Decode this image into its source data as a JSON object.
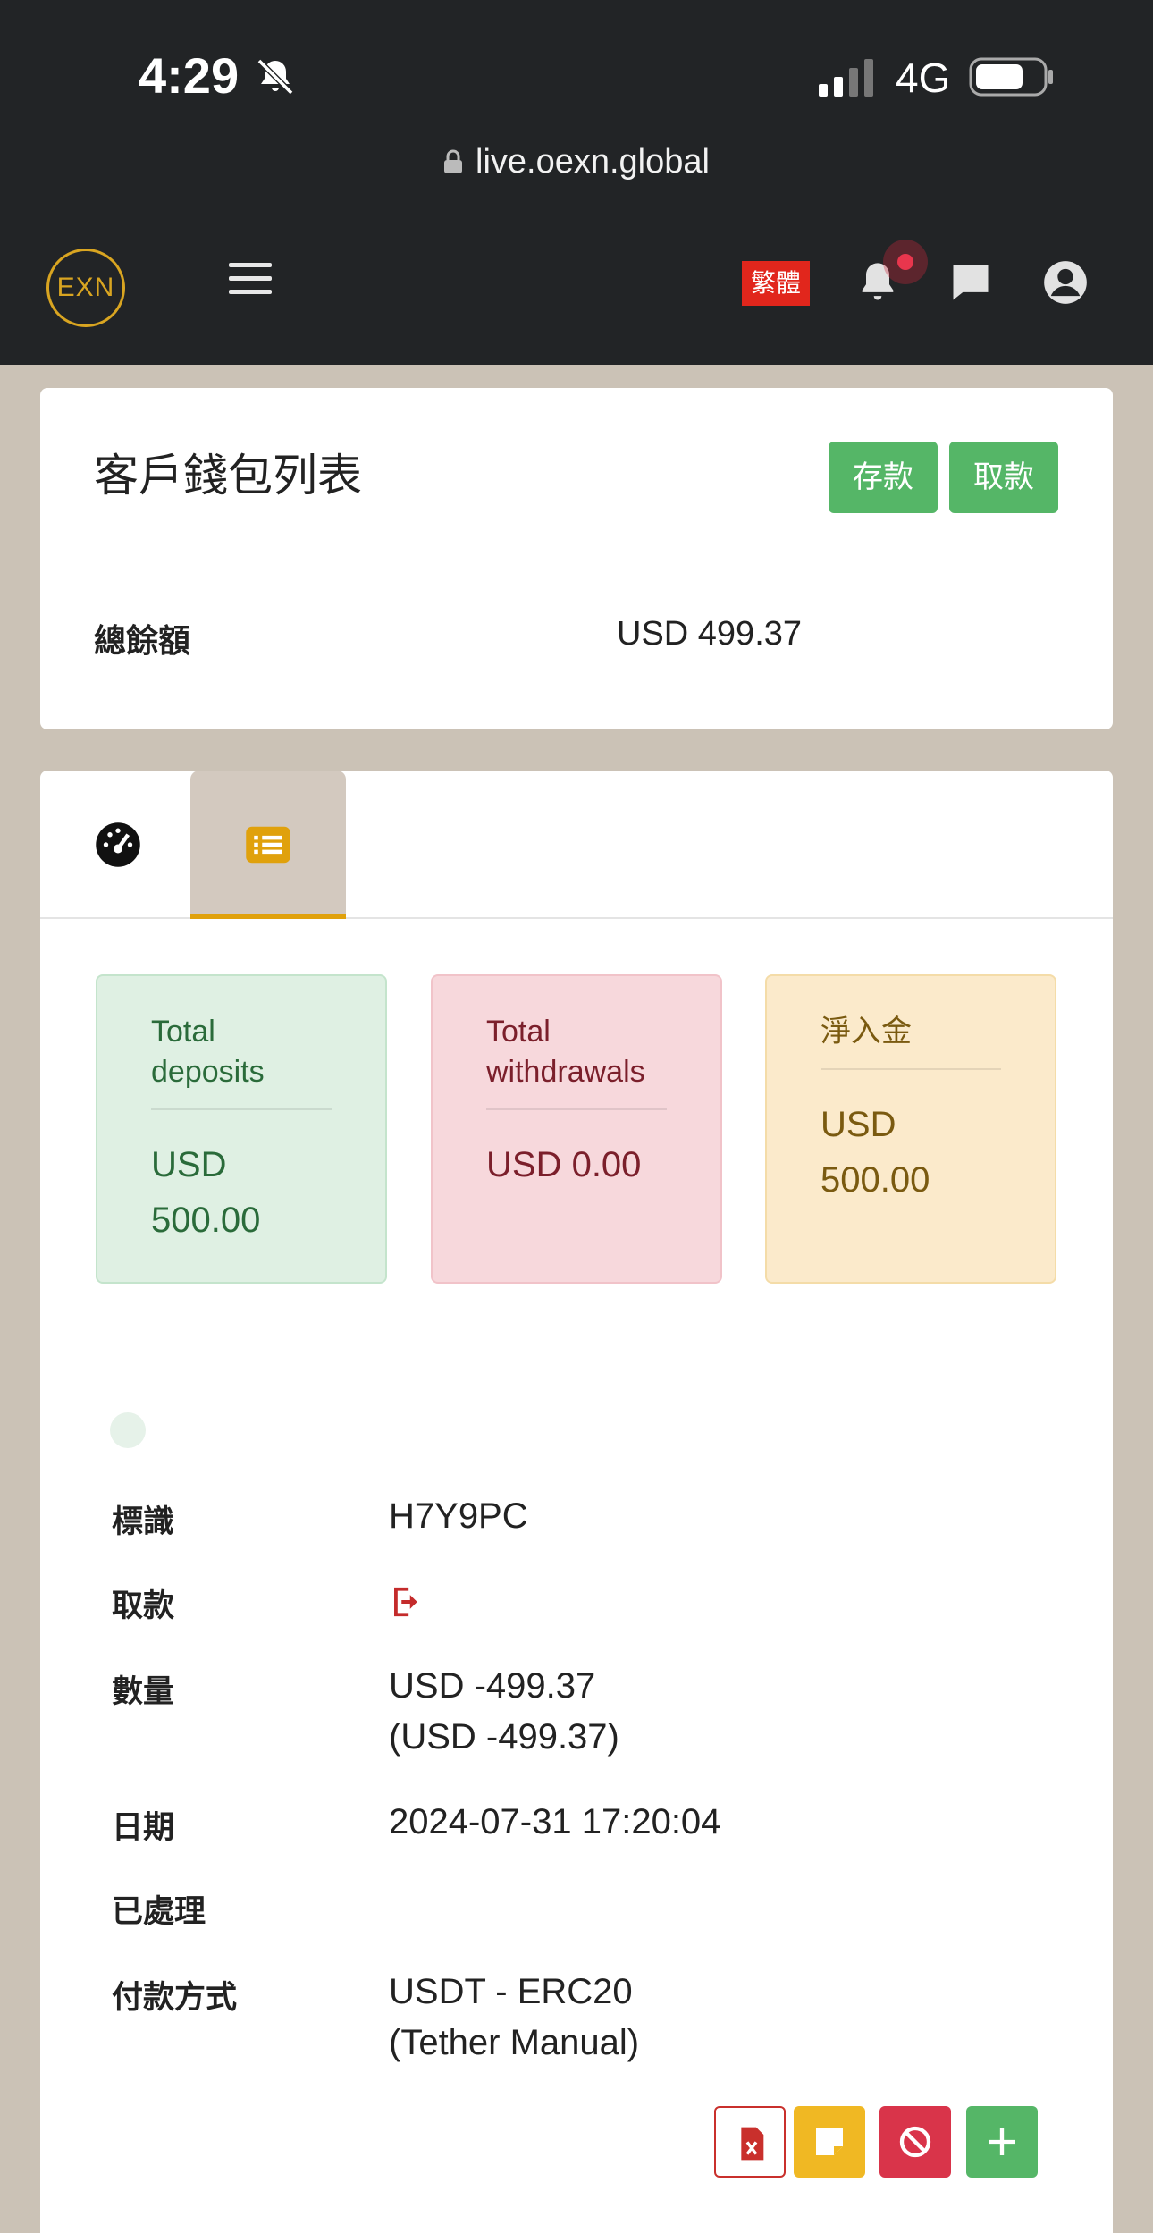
{
  "status_bar": {
    "time": "4:29",
    "network": "4G"
  },
  "browser": {
    "url": "live.oexn.global"
  },
  "header": {
    "logo_text": "EXN",
    "language_label": "繁體"
  },
  "wallet": {
    "title": "客戶錢包列表",
    "deposit_button": "存款",
    "withdraw_button": "取款",
    "total_balance_label": "總餘額",
    "total_balance_value": "USD 499.37"
  },
  "stats": {
    "deposits": {
      "label": "Total deposits",
      "value": "USD 500.00"
    },
    "withdrawals": {
      "label": "Total withdrawals",
      "value": "USD 0.00"
    },
    "net_deposit": {
      "label": "淨入金",
      "value": "USD 500.00"
    }
  },
  "transaction": {
    "id_label": "標識",
    "id_value": "H7Y9PC",
    "type_label": "取款",
    "amount_label": "數量",
    "amount_value": "USD -499.37",
    "amount_sub": "(USD -499.37)",
    "date_label": "日期",
    "date_value": "2024-07-31 17:20:04",
    "processed_label": "已處理",
    "method_label": "付款方式",
    "method_value": "USDT - ERC20",
    "method_sub": "(Tether Manual)"
  },
  "colors": {
    "accent_green": "#55b667",
    "accent_yellow": "#f0b823",
    "accent_red": "#d9344a",
    "tab_active": "#e0a10c"
  }
}
